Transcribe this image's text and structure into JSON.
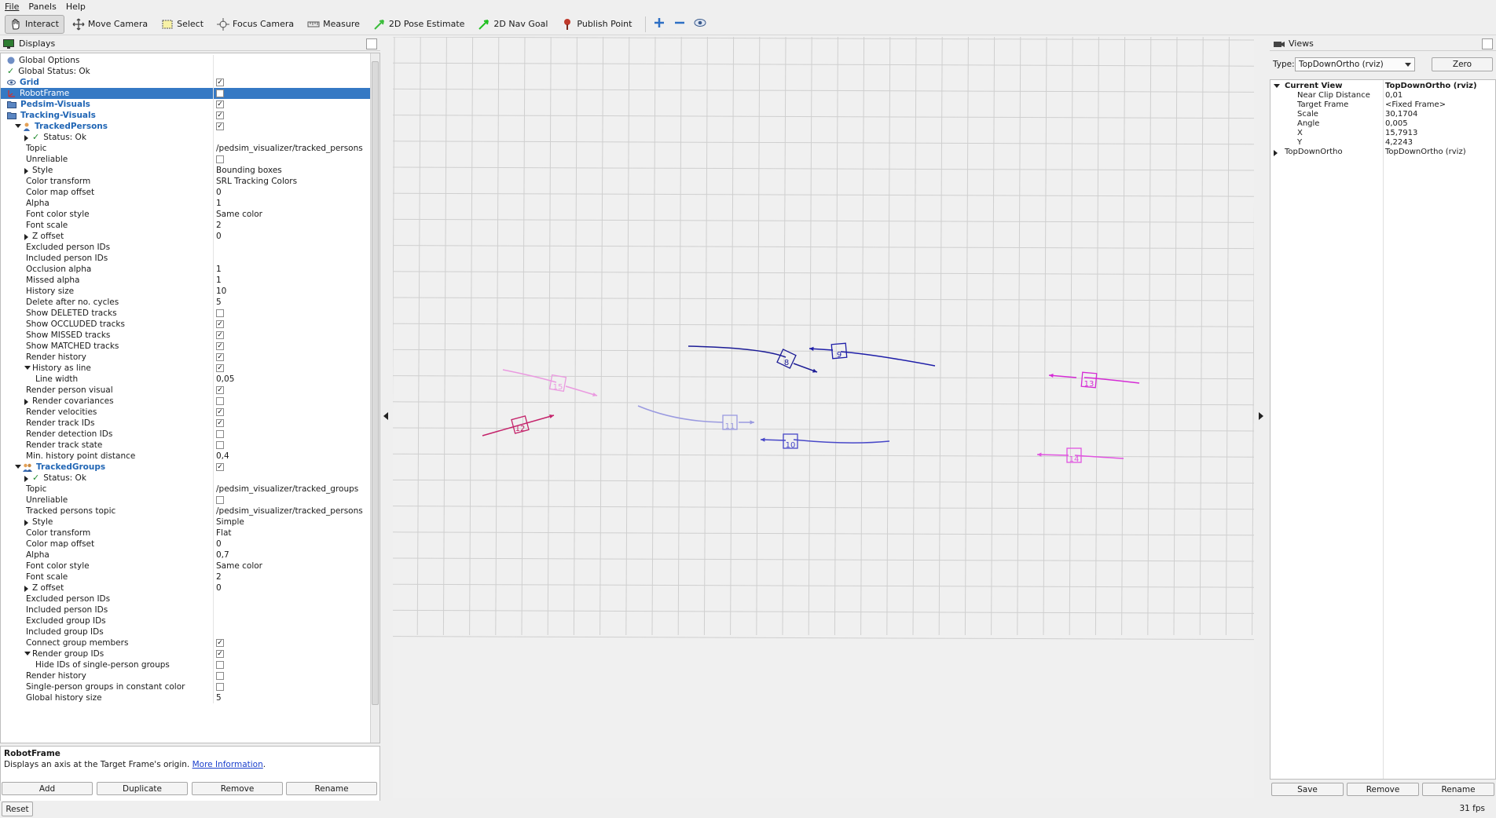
{
  "menu": [
    "File",
    "Panels",
    "Help"
  ],
  "toolbar": {
    "tools": [
      {
        "label": "Interact",
        "icon": "hand-icon",
        "active": true
      },
      {
        "label": "Move Camera",
        "icon": "move-camera-icon",
        "active": false
      },
      {
        "label": "Select",
        "icon": "select-icon",
        "active": false
      },
      {
        "label": "Focus Camera",
        "icon": "focus-camera-icon",
        "active": false
      },
      {
        "label": "Measure",
        "icon": "ruler-icon",
        "active": false
      },
      {
        "label": "2D Pose Estimate",
        "icon": "pose-arrow-icon",
        "active": false
      },
      {
        "label": "2D Nav Goal",
        "icon": "goal-arrow-icon",
        "active": false
      },
      {
        "label": "Publish Point",
        "icon": "pin-icon",
        "active": false
      }
    ],
    "extra_icons": [
      "add-tool-icon",
      "remove-tool-icon",
      "eye-icon"
    ]
  },
  "displays": {
    "title": "Displays",
    "rows": [
      {
        "name": "Global Options",
        "value": "",
        "indent": 0,
        "icon": "globe",
        "kind": "text"
      },
      {
        "name": "Global Status: Ok",
        "value": "",
        "indent": 0,
        "icon": "check",
        "kind": "text"
      },
      {
        "name": "Grid",
        "value": "",
        "indent": 0,
        "icon": "eye",
        "kind": "check",
        "checked": true,
        "style": "bluebold"
      },
      {
        "name": "RobotFrame",
        "value": "",
        "indent": 0,
        "icon": "axes",
        "kind": "check",
        "checked": false,
        "selected": true
      },
      {
        "name": "Pedsim-Visuals",
        "value": "",
        "indent": 0,
        "icon": "folder",
        "kind": "check",
        "checked": true,
        "style": "bluebold"
      },
      {
        "name": "Tracking-Visuals",
        "value": "",
        "indent": 0,
        "icon": "folder",
        "kind": "check",
        "checked": true,
        "style": "bluebold"
      },
      {
        "name": "TrackedPersons",
        "value": "",
        "indent": 1,
        "icon": "person",
        "kind": "check",
        "checked": true,
        "style": "bluebold",
        "expand": "down"
      },
      {
        "name": "Status: Ok",
        "value": "",
        "indent": 2,
        "icon": "check",
        "kind": "text",
        "expand": "right"
      },
      {
        "name": "Topic",
        "value": "/pedsim_visualizer/tracked_persons",
        "indent": 2,
        "kind": "text"
      },
      {
        "name": "Unreliable",
        "value": "",
        "indent": 2,
        "kind": "check",
        "checked": false
      },
      {
        "name": "Style",
        "value": "Bounding boxes",
        "indent": 2,
        "kind": "text",
        "expand": "right"
      },
      {
        "name": "Color transform",
        "value": "SRL Tracking Colors",
        "indent": 2,
        "kind": "text"
      },
      {
        "name": "Color map offset",
        "value": "0",
        "indent": 2,
        "kind": "text"
      },
      {
        "name": "Alpha",
        "value": "1",
        "indent": 2,
        "kind": "text"
      },
      {
        "name": "Font color style",
        "value": "Same color",
        "indent": 2,
        "kind": "text"
      },
      {
        "name": "Font scale",
        "value": "2",
        "indent": 2,
        "kind": "text"
      },
      {
        "name": "Z offset",
        "value": "0",
        "indent": 2,
        "kind": "text",
        "expand": "right"
      },
      {
        "name": "Excluded person IDs",
        "value": "",
        "indent": 2,
        "kind": "text"
      },
      {
        "name": "Included person IDs",
        "value": "",
        "indent": 2,
        "kind": "text"
      },
      {
        "name": "Occlusion alpha",
        "value": "1",
        "indent": 2,
        "kind": "text"
      },
      {
        "name": "Missed alpha",
        "value": "1",
        "indent": 2,
        "kind": "text"
      },
      {
        "name": "History size",
        "value": "10",
        "indent": 2,
        "kind": "text"
      },
      {
        "name": "Delete after no. cycles",
        "value": "5",
        "indent": 2,
        "kind": "text"
      },
      {
        "name": "Show DELETED tracks",
        "value": "",
        "indent": 2,
        "kind": "check",
        "checked": false
      },
      {
        "name": "Show OCCLUDED tracks",
        "value": "",
        "indent": 2,
        "kind": "check",
        "checked": true
      },
      {
        "name": "Show MISSED tracks",
        "value": "",
        "indent": 2,
        "kind": "check",
        "checked": true
      },
      {
        "name": "Show MATCHED tracks",
        "value": "",
        "indent": 2,
        "kind": "check",
        "checked": true
      },
      {
        "name": "Render history",
        "value": "",
        "indent": 2,
        "kind": "check",
        "checked": true
      },
      {
        "name": "History as line",
        "value": "",
        "indent": 2,
        "kind": "check",
        "checked": true,
        "expand": "down"
      },
      {
        "name": "Line width",
        "value": "0,05",
        "indent": 3,
        "kind": "text"
      },
      {
        "name": "Render person visual",
        "value": "",
        "indent": 2,
        "kind": "check",
        "checked": true
      },
      {
        "name": "Render covariances",
        "value": "",
        "indent": 2,
        "kind": "check",
        "checked": false,
        "expand": "right"
      },
      {
        "name": "Render velocities",
        "value": "",
        "indent": 2,
        "kind": "check",
        "checked": true
      },
      {
        "name": "Render track IDs",
        "value": "",
        "indent": 2,
        "kind": "check",
        "checked": true
      },
      {
        "name": "Render detection IDs",
        "value": "",
        "indent": 2,
        "kind": "check",
        "checked": false
      },
      {
        "name": "Render track state",
        "value": "",
        "indent": 2,
        "kind": "check",
        "checked": false
      },
      {
        "name": "Min. history point distance",
        "value": "0,4",
        "indent": 2,
        "kind": "text"
      },
      {
        "name": "TrackedGroups",
        "value": "",
        "indent": 1,
        "icon": "group",
        "kind": "check",
        "checked": true,
        "style": "bluebold",
        "expand": "down"
      },
      {
        "name": "Status: Ok",
        "value": "",
        "indent": 2,
        "icon": "check",
        "kind": "text",
        "expand": "right"
      },
      {
        "name": "Topic",
        "value": "/pedsim_visualizer/tracked_groups",
        "indent": 2,
        "kind": "text"
      },
      {
        "name": "Unreliable",
        "value": "",
        "indent": 2,
        "kind": "check",
        "checked": false
      },
      {
        "name": "Tracked persons topic",
        "value": "/pedsim_visualizer/tracked_persons",
        "indent": 2,
        "kind": "text"
      },
      {
        "name": "Style",
        "value": "Simple",
        "indent": 2,
        "kind": "text",
        "expand": "right"
      },
      {
        "name": "Color transform",
        "value": "Flat",
        "indent": 2,
        "kind": "text"
      },
      {
        "name": "Color map offset",
        "value": "0",
        "indent": 2,
        "kind": "text"
      },
      {
        "name": "Alpha",
        "value": "0,7",
        "indent": 2,
        "kind": "text"
      },
      {
        "name": "Font color style",
        "value": "Same color",
        "indent": 2,
        "kind": "text"
      },
      {
        "name": "Font scale",
        "value": "2",
        "indent": 2,
        "kind": "text"
      },
      {
        "name": "Z offset",
        "value": "0",
        "indent": 2,
        "kind": "text",
        "expand": "right"
      },
      {
        "name": "Excluded person IDs",
        "value": "",
        "indent": 2,
        "kind": "text"
      },
      {
        "name": "Included person IDs",
        "value": "",
        "indent": 2,
        "kind": "text"
      },
      {
        "name": "Excluded group IDs",
        "value": "",
        "indent": 2,
        "kind": "text"
      },
      {
        "name": "Included group IDs",
        "value": "",
        "indent": 2,
        "kind": "text"
      },
      {
        "name": "Connect group members",
        "value": "",
        "indent": 2,
        "kind": "check",
        "checked": true
      },
      {
        "name": "Render group IDs",
        "value": "",
        "indent": 2,
        "kind": "check",
        "checked": true,
        "expand": "down"
      },
      {
        "name": "Hide IDs of single-person groups",
        "value": "",
        "indent": 3,
        "kind": "check",
        "checked": false
      },
      {
        "name": "Render history",
        "value": "",
        "indent": 2,
        "kind": "check",
        "checked": false
      },
      {
        "name": "Single-person groups in constant color",
        "value": "",
        "indent": 2,
        "kind": "check",
        "checked": false
      },
      {
        "name": "Global history size",
        "value": "5",
        "indent": 2,
        "kind": "text"
      }
    ],
    "description": {
      "title": "RobotFrame",
      "text": "Displays an axis at the Target Frame's origin.",
      "link": "More Information"
    },
    "buttons": {
      "add": "Add",
      "duplicate": "Duplicate",
      "remove": "Remove",
      "rename": "Rename"
    }
  },
  "views": {
    "title": "Views",
    "type_label": "Type:",
    "type_value": "TopDownOrtho (rviz)",
    "zero_label": "Zero",
    "rows": [
      {
        "name": "Current View",
        "value": "TopDownOrtho (rviz)",
        "indent": 0,
        "bold": true,
        "expand": "down"
      },
      {
        "name": "Near Clip Distance",
        "value": "0,01",
        "indent": 1
      },
      {
        "name": "Target Frame",
        "value": "<Fixed Frame>",
        "indent": 1
      },
      {
        "name": "Scale",
        "value": "30,1704",
        "indent": 1
      },
      {
        "name": "Angle",
        "value": "0,005",
        "indent": 1
      },
      {
        "name": "X",
        "value": "15,7913",
        "indent": 1
      },
      {
        "name": "Y",
        "value": "4,2243",
        "indent": 1
      },
      {
        "name": "TopDownOrtho",
        "value": "TopDownOrtho (rviz)",
        "indent": 0,
        "expand": "right"
      }
    ],
    "buttons": {
      "save": "Save",
      "remove": "Remove",
      "rename": "Rename"
    }
  },
  "scene": {
    "tracks": [
      {
        "id": "8",
        "color": "#1c1c96"
      },
      {
        "id": "9",
        "color": "#1e1ea8"
      },
      {
        "id": "10",
        "color": "#4848c8"
      },
      {
        "id": "11",
        "color": "#9a9ae0"
      },
      {
        "id": "12",
        "color": "#c4226a"
      },
      {
        "id": "13",
        "color": "#d52bd5"
      },
      {
        "id": "14",
        "color": "#e055e0"
      },
      {
        "id": "15",
        "color": "#ea9ae0"
      }
    ]
  },
  "status": {
    "reset": "Reset",
    "fps": "31 fps"
  }
}
